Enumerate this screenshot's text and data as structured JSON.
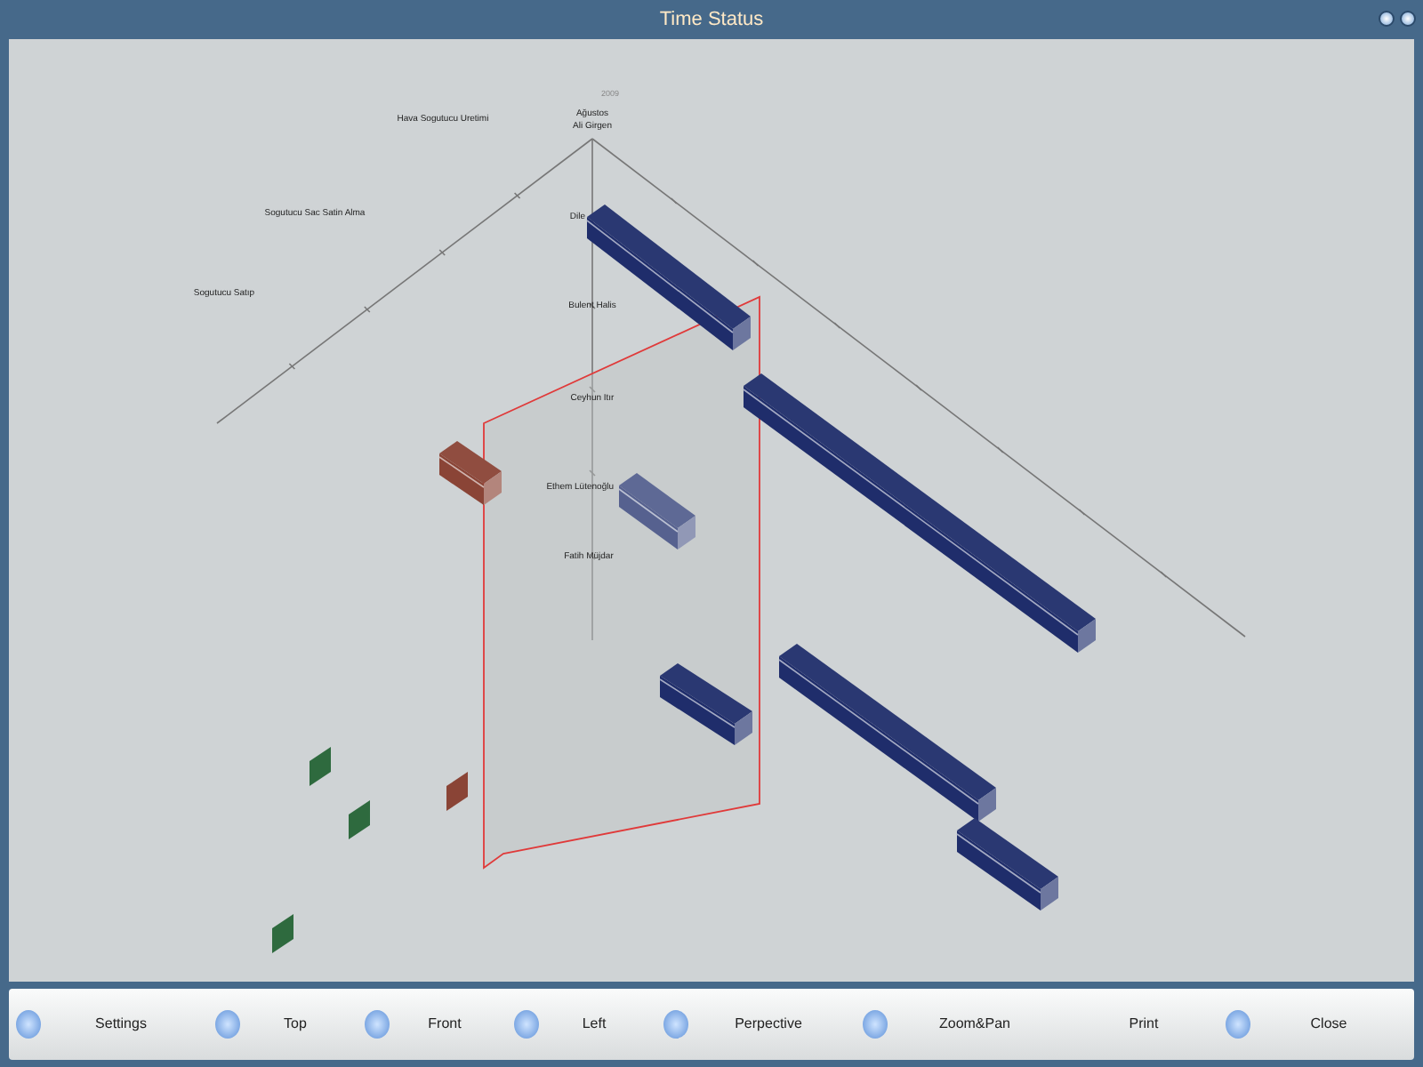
{
  "window": {
    "title": "Time Status"
  },
  "chart": {
    "year": "2009",
    "month": "Ağustos",
    "top_person": "Ali Girgen",
    "tasks": [
      "Hava Sogutucu Uretimi",
      "Sogutucu Sac Satin Alma",
      "Sogutucu Satıp"
    ],
    "people": [
      "Dile",
      "Bulent Halis",
      "Ceyhun Itır",
      "Ethem Lütenoğlu",
      "Fatih Müjdar"
    ],
    "bars": [
      {
        "color": "#1f2d6b"
      },
      {
        "color": "#1f2d6b"
      },
      {
        "color": "#56618f"
      },
      {
        "color": "#8a4436"
      },
      {
        "color": "#1f2d6b"
      },
      {
        "color": "#1f2d6b"
      },
      {
        "color": "#1f2d6b"
      },
      {
        "color": "#2e6a3e"
      },
      {
        "color": "#2e6a3e"
      },
      {
        "color": "#2e6a3e"
      },
      {
        "color": "#8a4436"
      }
    ]
  },
  "toolbar": [
    {
      "label": "Settings",
      "kind": "icon"
    },
    {
      "label": "Top",
      "kind": "icon"
    },
    {
      "label": "Front",
      "kind": "icon"
    },
    {
      "label": "Left",
      "kind": "icon"
    },
    {
      "label": "Perpective",
      "kind": "icon"
    },
    {
      "label": "Zoom&Pan",
      "kind": "icon"
    },
    {
      "label": "Print",
      "kind": "plain"
    },
    {
      "label": "Close",
      "kind": "icon"
    }
  ]
}
